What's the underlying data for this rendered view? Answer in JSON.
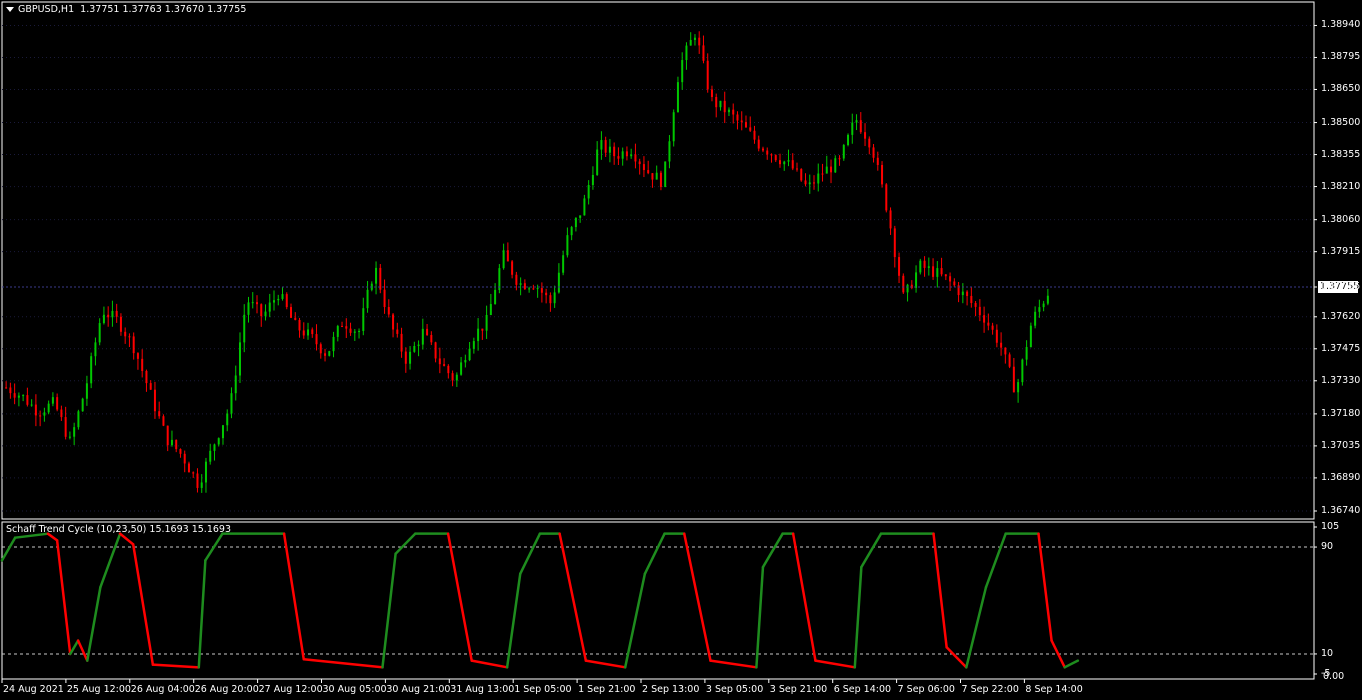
{
  "header": {
    "symbol": "GBPUSD,H1",
    "ohlc": "1.37751 1.37763 1.37670 1.37755"
  },
  "current_price": "1.37755",
  "indicator": {
    "title": "Schaff Trend Cycle (10,23,50) 15.1693 15.1693",
    "levels": [
      "105",
      "90",
      "10",
      "-5"
    ],
    "level_min_label": "0.00"
  },
  "colors": {
    "background": "#000000",
    "bull_candle": "#00c800",
    "bear_candle": "#ff0000",
    "stc_up": "#1e8c1e",
    "stc_down": "#ff0000",
    "grid": "#1a1a3a",
    "frame": "#ffffff"
  },
  "chart_data": {
    "type": "candlestick",
    "symbol": "GBPUSD",
    "timeframe": "H1",
    "y_ticks": [
      "1.38940",
      "1.38795",
      "1.38650",
      "1.38500",
      "1.38355",
      "1.38210",
      "1.38060",
      "1.37915",
      "1.37755",
      "1.37620",
      "1.37475",
      "1.37330",
      "1.37180",
      "1.37035",
      "1.36890",
      "1.36740"
    ],
    "ylim": [
      1.3674,
      1.3901
    ],
    "x_ticks": [
      "24 Aug 2021",
      "25 Aug 12:00",
      "26 Aug 04:00",
      "26 Aug 20:00",
      "27 Aug 12:00",
      "30 Aug 05:00",
      "30 Aug 21:00",
      "31 Aug 13:00",
      "1 Sep 05:00",
      "1 Sep 21:00",
      "2 Sep 13:00",
      "3 Sep 05:00",
      "3 Sep 21:00",
      "6 Sep 14:00",
      "7 Sep 06:00",
      "7 Sep 22:00",
      "8 Sep 14:00"
    ],
    "price_path": [
      1.373,
      1.3726,
      1.3719,
      1.3723,
      1.3705,
      1.3731,
      1.3765,
      1.376,
      1.3748,
      1.3727,
      1.3707,
      1.3699,
      1.3686,
      1.3705,
      1.3722,
      1.377,
      1.3762,
      1.3773,
      1.3758,
      1.3753,
      1.3745,
      1.376,
      1.3755,
      1.3785,
      1.3758,
      1.3742,
      1.3755,
      1.3742,
      1.3733,
      1.3752,
      1.376,
      1.379,
      1.3777,
      1.3777,
      1.3768,
      1.3797,
      1.3812,
      1.384,
      1.3835,
      1.3838,
      1.3828,
      1.3823,
      1.3875,
      1.3891,
      1.386,
      1.3855,
      1.3848,
      1.384,
      1.3835,
      1.383,
      1.382,
      1.3828,
      1.3832,
      1.3852,
      1.384,
      1.381,
      1.377,
      1.3785,
      1.3782,
      1.3777,
      1.377,
      1.3762,
      1.375,
      1.3728,
      1.376,
      1.3773
    ],
    "stc": {
      "ylim": [
        -5,
        105
      ],
      "levels": [
        10,
        90
      ],
      "keypoints": [
        [
          0,
          80
        ],
        [
          0.01,
          97
        ],
        [
          0.035,
          100
        ],
        [
          0.042,
          95
        ],
        [
          0.052,
          10
        ],
        [
          0.058,
          20
        ],
        [
          0.065,
          5
        ],
        [
          0.075,
          60
        ],
        [
          0.09,
          100
        ],
        [
          0.1,
          92
        ],
        [
          0.115,
          2
        ],
        [
          0.15,
          0
        ],
        [
          0.155,
          80
        ],
        [
          0.168,
          100
        ],
        [
          0.215,
          100
        ],
        [
          0.23,
          6
        ],
        [
          0.29,
          0
        ],
        [
          0.3,
          85
        ],
        [
          0.315,
          100
        ],
        [
          0.34,
          100
        ],
        [
          0.358,
          5
        ],
        [
          0.385,
          0
        ],
        [
          0.395,
          70
        ],
        [
          0.41,
          100
        ],
        [
          0.425,
          100
        ],
        [
          0.445,
          5
        ],
        [
          0.475,
          0
        ],
        [
          0.49,
          70
        ],
        [
          0.505,
          100
        ],
        [
          0.52,
          100
        ],
        [
          0.54,
          5
        ],
        [
          0.575,
          0
        ],
        [
          0.58,
          75
        ],
        [
          0.595,
          100
        ],
        [
          0.603,
          100
        ],
        [
          0.62,
          5
        ],
        [
          0.65,
          0
        ],
        [
          0.655,
          75
        ],
        [
          0.67,
          100
        ],
        [
          0.71,
          100
        ],
        [
          0.72,
          15
        ],
        [
          0.735,
          0
        ],
        [
          0.75,
          60
        ],
        [
          0.765,
          100
        ],
        [
          0.79,
          100
        ],
        [
          0.8,
          20
        ],
        [
          0.81,
          0
        ],
        [
          0.82,
          5
        ]
      ]
    }
  }
}
